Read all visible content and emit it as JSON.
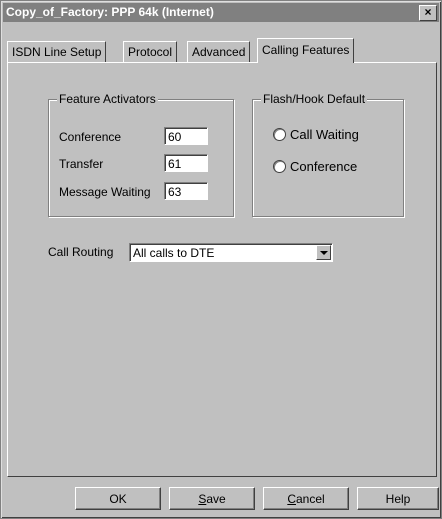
{
  "window": {
    "title": "Copy_of_Factory: PPP 64k (Internet)",
    "close_glyph": "×"
  },
  "tabs": [
    {
      "label": "ISDN Line Setup"
    },
    {
      "label": "Protocol"
    },
    {
      "label": "Advanced"
    },
    {
      "label": "Calling Features",
      "active": true
    }
  ],
  "feature_activators": {
    "title": "Feature Activators",
    "conference_label": "Conference",
    "conference_value": "60",
    "transfer_label": "Transfer",
    "transfer_value": "61",
    "message_waiting_label": "Message Waiting",
    "message_waiting_value": "63"
  },
  "flash_hook": {
    "title": "Flash/Hook Default",
    "options": [
      {
        "label": "Call Waiting",
        "selected": false
      },
      {
        "label": "Conference",
        "selected": false
      }
    ]
  },
  "call_routing": {
    "label": "Call Routing",
    "value": "All calls to DTE"
  },
  "buttons": {
    "ok": "OK",
    "save_first": "S",
    "save_rest": "ave",
    "cancel_first": "C",
    "cancel_rest": "ancel",
    "help": "Help"
  }
}
